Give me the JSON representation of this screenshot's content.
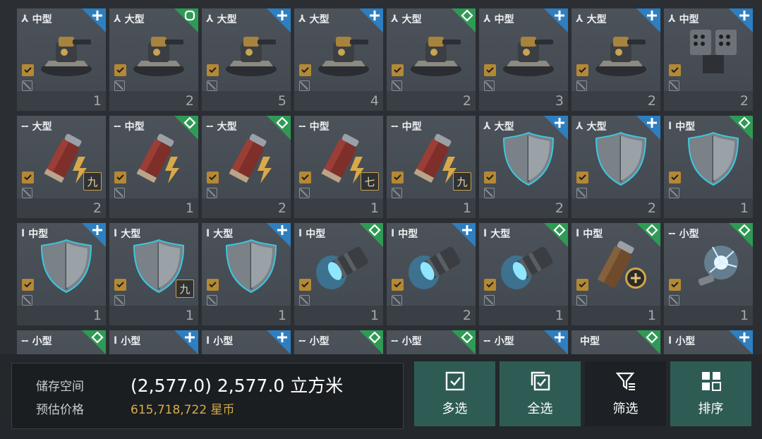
{
  "colors": {
    "tile_bg": "#4c5259",
    "corner_blue": "#2e7fc0",
    "corner_green": "#2f9a55",
    "check_gold": "#b48834",
    "price_gold": "#d8ad48",
    "button_teal": "#2e5c55",
    "button_dark": "#1d2125"
  },
  "inventory": {
    "items": [
      {
        "glyph": "⅄",
        "size": "中型",
        "corner": "blue",
        "symbol": "plus",
        "count": "1",
        "icon": "turret-icon",
        "badge": ""
      },
      {
        "glyph": "⅄",
        "size": "大型",
        "corner": "green",
        "symbol": "circle",
        "count": "2",
        "icon": "turret-icon",
        "badge": ""
      },
      {
        "glyph": "⅄",
        "size": "大型",
        "corner": "blue",
        "symbol": "plus",
        "count": "5",
        "icon": "turret-icon",
        "badge": ""
      },
      {
        "glyph": "⅄",
        "size": "大型",
        "corner": "blue",
        "symbol": "plus",
        "count": "4",
        "icon": "turret-icon",
        "badge": ""
      },
      {
        "glyph": "⅄",
        "size": "大型",
        "corner": "green",
        "symbol": "diamond",
        "count": "2",
        "icon": "turret-icon",
        "badge": ""
      },
      {
        "glyph": "⅄",
        "size": "中型",
        "corner": "blue",
        "symbol": "plus",
        "count": "3",
        "icon": "turret-icon",
        "badge": ""
      },
      {
        "glyph": "⅄",
        "size": "大型",
        "corner": "blue",
        "symbol": "plus",
        "count": "2",
        "icon": "turret-icon",
        "badge": ""
      },
      {
        "glyph": "⅄",
        "size": "中型",
        "corner": "blue",
        "symbol": "plus",
        "count": "2",
        "icon": "missile-launcher-icon",
        "badge": ""
      },
      {
        "glyph": "--",
        "size": "大型",
        "corner": "none",
        "symbol": "",
        "count": "2",
        "icon": "canister-icon",
        "badge": "九"
      },
      {
        "glyph": "--",
        "size": "中型",
        "corner": "green",
        "symbol": "diamond",
        "count": "1",
        "icon": "canister-icon",
        "badge": ""
      },
      {
        "glyph": "--",
        "size": "大型",
        "corner": "green",
        "symbol": "diamond",
        "count": "2",
        "icon": "canister-icon",
        "badge": ""
      },
      {
        "glyph": "--",
        "size": "中型",
        "corner": "none",
        "symbol": "",
        "count": "1",
        "icon": "canister-icon",
        "badge": "七"
      },
      {
        "glyph": "--",
        "size": "中型",
        "corner": "none",
        "symbol": "",
        "count": "1",
        "icon": "canister-icon",
        "badge": "九"
      },
      {
        "glyph": "⅄",
        "size": "大型",
        "corner": "blue",
        "symbol": "plus",
        "count": "2",
        "icon": "shield-icon",
        "badge": ""
      },
      {
        "glyph": "⅄",
        "size": "大型",
        "corner": "blue",
        "symbol": "plus",
        "count": "2",
        "icon": "shield-icon",
        "badge": ""
      },
      {
        "glyph": "I",
        "size": "中型",
        "corner": "green",
        "symbol": "diamond",
        "count": "1",
        "icon": "shield-icon",
        "badge": ""
      },
      {
        "glyph": "I",
        "size": "中型",
        "corner": "blue",
        "symbol": "plus",
        "count": "1",
        "icon": "shield-icon",
        "badge": ""
      },
      {
        "glyph": "I",
        "size": "大型",
        "corner": "none",
        "symbol": "",
        "count": "1",
        "icon": "shield-icon",
        "badge": "九"
      },
      {
        "glyph": "I",
        "size": "大型",
        "corner": "blue",
        "symbol": "plus",
        "count": "1",
        "icon": "shield-icon",
        "badge": ""
      },
      {
        "glyph": "I",
        "size": "中型",
        "corner": "green",
        "symbol": "diamond",
        "count": "1",
        "icon": "energy-thruster-icon",
        "badge": ""
      },
      {
        "glyph": "I",
        "size": "中型",
        "corner": "blue",
        "symbol": "plus",
        "count": "2",
        "icon": "energy-thruster-icon",
        "badge": ""
      },
      {
        "glyph": "I",
        "size": "大型",
        "corner": "green",
        "symbol": "diamond",
        "count": "1",
        "icon": "energy-thruster-icon",
        "badge": ""
      },
      {
        "glyph": "I",
        "size": "中型",
        "corner": "green",
        "symbol": "diamond",
        "count": "1",
        "icon": "repair-canister-icon",
        "badge": ""
      },
      {
        "glyph": "--",
        "size": "小型",
        "corner": "green",
        "symbol": "diamond",
        "count": "1",
        "icon": "lightning-orb-icon",
        "badge": ""
      },
      {
        "glyph": "--",
        "size": "小型",
        "corner": "green",
        "symbol": "diamond",
        "count": "",
        "icon": "module-icon",
        "badge": ""
      },
      {
        "glyph": "I",
        "size": "小型",
        "corner": "blue",
        "symbol": "plus",
        "count": "",
        "icon": "module-icon",
        "badge": ""
      },
      {
        "glyph": "I",
        "size": "小型",
        "corner": "blue",
        "symbol": "plus",
        "count": "",
        "icon": "module-icon",
        "badge": ""
      },
      {
        "glyph": "--",
        "size": "小型",
        "corner": "green",
        "symbol": "diamond",
        "count": "",
        "icon": "module-icon",
        "badge": ""
      },
      {
        "glyph": "--",
        "size": "小型",
        "corner": "green",
        "symbol": "diamond",
        "count": "",
        "icon": "module-icon",
        "badge": ""
      },
      {
        "glyph": "--",
        "size": "小型",
        "corner": "blue",
        "symbol": "plus",
        "count": "",
        "icon": "module-icon",
        "badge": ""
      },
      {
        "glyph": "",
        "size": "中型",
        "corner": "green",
        "symbol": "diamond",
        "count": "",
        "icon": "module-icon",
        "badge": ""
      },
      {
        "glyph": "I",
        "size": "小型",
        "corner": "blue",
        "symbol": "plus",
        "count": "",
        "icon": "module-icon",
        "badge": ""
      }
    ]
  },
  "storage": {
    "space_label": "储存空间",
    "space_value": "(2,577.0) 2,577.0 立方米",
    "price_label": "预估价格",
    "price_value": "615,718,722 星币"
  },
  "actions": {
    "multi_select": "多选",
    "select_all": "全选",
    "filter": "筛选",
    "sort": "排序"
  }
}
